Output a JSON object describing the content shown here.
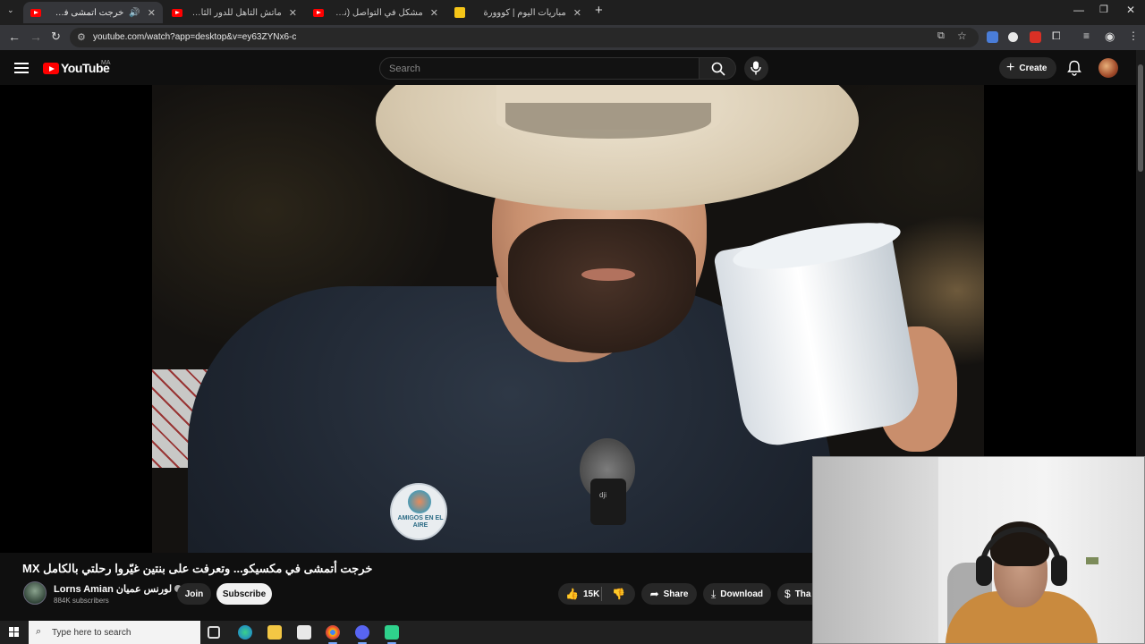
{
  "browser": {
    "tabs": [
      {
        "title": "خرجت أتمشى في مكسيكو...",
        "active": true,
        "audio": true
      },
      {
        "title": "ماتش التأهل للدور الثاني؟ التشكيل",
        "active": false
      },
      {
        "title": "مشكل في التواصل (نظرية البراكين)",
        "active": false
      },
      {
        "title": "مباريات اليوم | كووورة",
        "active": false
      }
    ],
    "url": "youtube.com/watch?app=desktop&v=ey63ZYNx6-c"
  },
  "youtube": {
    "logo_text": "YouTube",
    "country_code": "MA",
    "search_placeholder": "Search",
    "create_label": "Create"
  },
  "video": {
    "title": "خرجت أتمشى في مكسيكو... وتعرفت على بنتين غيّروا رحلتي بالكامل MX",
    "pin_text": "AMIGOS EN EL AIRE",
    "mic_brand": "dji"
  },
  "channel": {
    "name": "Lorns Amian لورنس عميان",
    "subscribers": "884K subscribers",
    "join_label": "Join",
    "subscribe_label": "Subscribe"
  },
  "actions": {
    "likes": "15K",
    "share_label": "Share",
    "download_label": "Download",
    "thanks_label": "Tha"
  },
  "taskbar": {
    "search_placeholder": "Type here to search"
  },
  "colors": {
    "youtube_red": "#ff0000",
    "background": "#0f0f0f",
    "button_bg": "#272727"
  }
}
